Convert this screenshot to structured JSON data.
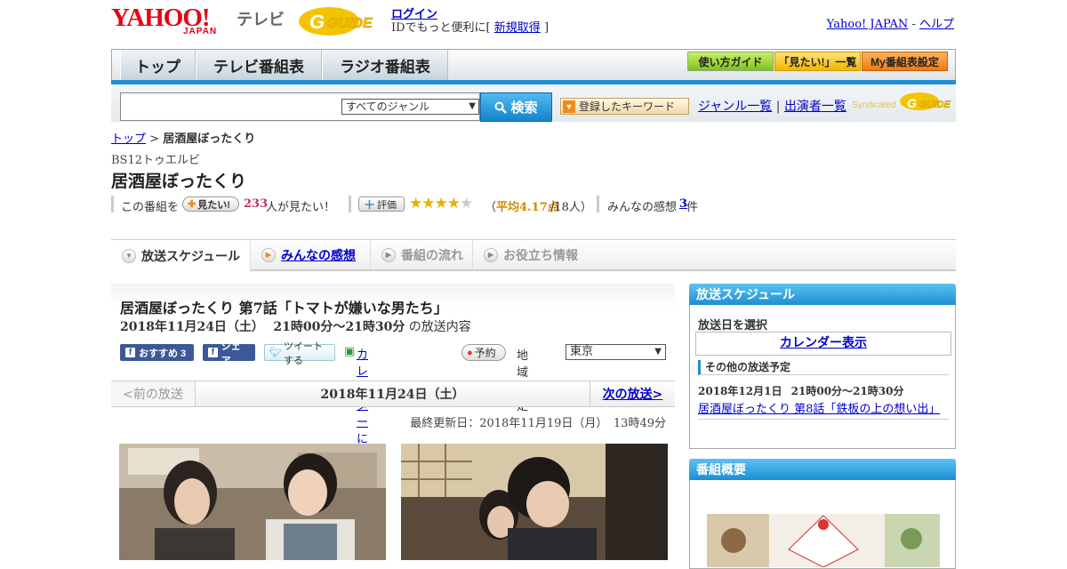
{
  "header": {
    "logo_yahoo": "YAHOO!",
    "logo_japan": "JAPAN",
    "logo_tv": "テレビ",
    "login_label": "ログイン",
    "promo_text": "IDでもっと便利に[",
    "signup_label": "新規取得",
    "promo_close": "]",
    "yahoo_japan_link": "Yahoo! JAPAN",
    "link_sep": "-",
    "help_link": "ヘルプ"
  },
  "nav": {
    "tabs": [
      "トップ",
      "テレビ番組表",
      "ラジオ番組表"
    ],
    "guide_buttons": [
      "使い方ガイド",
      "「見たい!」一覧",
      "My番組表設定"
    ]
  },
  "search": {
    "query": "",
    "genre_selected": "すべてのジャンル",
    "search_label": "検索",
    "keyword_label": "登録したキーワード",
    "genre_list_link": "ジャンル一覧",
    "link_sep": "|",
    "performer_list_link": "出演者一覧",
    "syndicated": "Syndicated"
  },
  "breadcrumb": {
    "home": "トップ",
    "sep": ">",
    "current": "居酒屋ぼったくり"
  },
  "program": {
    "channel": "BS12トゥエルビ",
    "title": "居酒屋ぼったくり",
    "want_prefix": "この番組を",
    "want_btn": "見たい!",
    "want_count": "233",
    "want_suffix": "人が見たい！",
    "rate_btn": "評価",
    "rating_stars": 4.17,
    "rating_open": "（",
    "rating_avg": "平均4.17点",
    "rating_count": "/18人）",
    "review_label": "みんなの感想",
    "review_count": "3",
    "review_suffix": "件"
  },
  "subtabs": [
    "放送スケジュール",
    "みんなの感想",
    "番組の流れ",
    "お役立ち情報"
  ],
  "episode": {
    "title": "居酒屋ぼったくり 第7話「トマトが嫌いな男たち」",
    "air_date": "2018年11月24日（土）",
    "air_time": "21時00分～21時30分",
    "air_suffix": "の放送内容",
    "fb_recommend": "おすすめ 3",
    "fb_share": "シェア",
    "tweet": "ツイートする",
    "calendar": "カレンダーに登録",
    "reserve": "予約",
    "region_label": "地域設定",
    "region_value": "東京"
  },
  "pager": {
    "prev": "<前の放送",
    "current": "2018年11月24日（土）",
    "next": "次の放送>"
  },
  "updated": "最終更新日：2018年11月19日（月）　13時49分",
  "sidebar": {
    "schedule_head": "放送スケジュール",
    "select_date": "放送日を選択",
    "calendar_link": "カレンダー表示",
    "other_head": "その他の放送予定",
    "next_date": "2018年12月1日",
    "next_time": "21時00分～21時30分",
    "next_title": "居酒屋ぼったくり 第8話「鉄板の上の想い出」",
    "overview_head": "番組概要"
  },
  "colors": {
    "accent_blue": "#1e8fd6",
    "brand_red": "#e60012",
    "star": "#e9b000",
    "pink": "#c0306a"
  }
}
